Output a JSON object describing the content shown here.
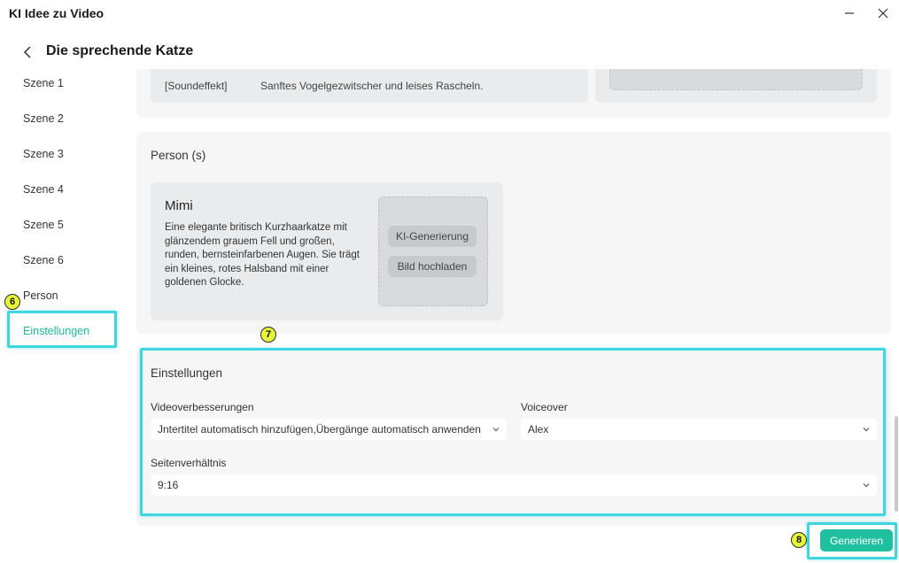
{
  "window": {
    "title": "KI Idee zu Video"
  },
  "header": {
    "title": "Die sprechende Katze"
  },
  "sidebar": {
    "items": [
      {
        "label": "Szene 1"
      },
      {
        "label": "Szene 2"
      },
      {
        "label": "Szene 3"
      },
      {
        "label": "Szene 4"
      },
      {
        "label": "Szene 5"
      },
      {
        "label": "Szene 6"
      },
      {
        "label": "Person"
      },
      {
        "label": "Einstellungen",
        "active": true
      }
    ]
  },
  "scene": {
    "sound_tag": "[Soundeffekt]",
    "sound_text": "Sanftes Vogelgezwitscher und leises Rascheln."
  },
  "person_section": {
    "title": "Person (s)",
    "card": {
      "name": "Mimi",
      "description": "Eine elegante britisch Kurzhaarkatze mit glänzendem grauem Fell und großen, runden, bernsteinfarbenen Augen. Sie trägt ein kleines, rotes Halsband mit einer goldenen Glocke.",
      "ki_button": "KI-Generierung",
      "upload_button": "Bild hochladen"
    }
  },
  "settings": {
    "title": "Einstellungen",
    "video_label": "Videoverbesserungen",
    "video_value": "Jntertitel automatisch hinzufügen,Übergänge automatisch anwenden",
    "voice_label": "Voiceover",
    "voice_value": "Alex",
    "ratio_label": "Seitenverhältnis",
    "ratio_value": "9:16"
  },
  "actions": {
    "generate": "Generieren"
  },
  "annotations": {
    "badge_6": "6",
    "badge_7": "7",
    "badge_8": "8"
  },
  "colors": {
    "accent": "#20bf9f",
    "highlight": "#3fd6e0",
    "badge": "#e6f53a"
  }
}
